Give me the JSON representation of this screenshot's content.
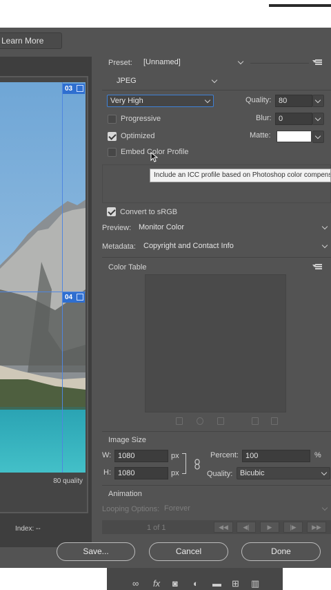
{
  "header": {
    "learn_more": "Learn More"
  },
  "preview": {
    "slice_top": "03",
    "slice_bottom": "04",
    "quality_readout": "80 quality",
    "index_readout": "Index: --"
  },
  "settings": {
    "preset_label": "Preset:",
    "preset_value": "[Unnamed]",
    "format_value": "JPEG",
    "compression_value": "Very High",
    "quality_label": "Quality:",
    "quality_value": "80",
    "progressive_label": "Progressive",
    "progressive_checked": false,
    "blur_label": "Blur:",
    "blur_value": "0",
    "optimized_label": "Optimized",
    "optimized_checked": true,
    "matte_label": "Matte:",
    "matte_color": "#ffffff",
    "embed_label": "Embed Color Profile",
    "embed_checked": false,
    "tooltip": "Include an ICC profile based on Photoshop color compensation",
    "convert_label": "Convert to sRGB",
    "convert_checked": true,
    "preview_label": "Preview:",
    "preview_value": "Monitor Color",
    "metadata_label": "Metadata:",
    "metadata_value": "Copyright and Contact Info"
  },
  "color_table": {
    "title": "Color Table"
  },
  "image_size": {
    "title": "Image Size",
    "w_label": "W:",
    "w_value": "1080",
    "h_label": "H:",
    "h_value": "1080",
    "unit": "px",
    "percent_label": "Percent:",
    "percent_value": "100",
    "percent_unit": "%",
    "quality_label": "Quality:",
    "quality_value": "Bicubic"
  },
  "animation": {
    "title": "Animation",
    "looping_label": "Looping Options:",
    "looping_value": "Forever",
    "frame_counter": "1 of 1"
  },
  "buttons": {
    "save": "Save...",
    "cancel": "Cancel",
    "done": "Done"
  },
  "colors": {
    "dialog_bg": "#535353",
    "slice_blue": "#2f6fd0",
    "tooltip_bg": "#f2f2f2"
  }
}
